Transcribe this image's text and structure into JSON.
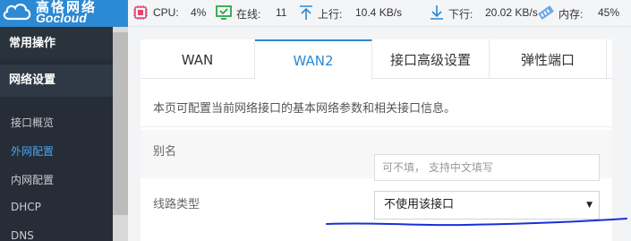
{
  "brand": {
    "name_cn": "高恪网络",
    "name_en": "Gocloud",
    "color": "#2c89d3"
  },
  "sidebar": {
    "groups": [
      {
        "label": "常用操作"
      },
      {
        "label": "网络设置"
      }
    ],
    "items": [
      {
        "label": "接口概览",
        "active": false
      },
      {
        "label": "外网配置",
        "active": true
      },
      {
        "label": "内网配置",
        "active": false
      },
      {
        "label": "DHCP",
        "active": false
      },
      {
        "label": "DNS",
        "active": false
      }
    ]
  },
  "status": {
    "cpu_label": "CPU:",
    "cpu_value": "4%",
    "online_label": "在线:",
    "online_value": "11",
    "upload_label": "上行:",
    "upload_value": "10.4 KB/s",
    "download_label": "下行:",
    "download_value": "20.02 KB/s",
    "memory_label": "内存:",
    "memory_value": "45%",
    "icons": [
      "cpu-icon",
      "monitor-icon",
      "upload-arrow-icon",
      "download-arrow-icon",
      "memory-icon"
    ]
  },
  "tabs": [
    {
      "label": "WAN",
      "active": false
    },
    {
      "label": "WAN2",
      "active": true
    },
    {
      "label": "接口高级设置",
      "active": false
    },
    {
      "label": "弹性端口",
      "active": false
    }
  ],
  "page": {
    "description": "本页可配置当前网络接口的基本网络参数和相关接口信息。"
  },
  "form": {
    "alias": {
      "label": "别名",
      "placeholder": "可不填， 支持中文填写",
      "value": ""
    },
    "line_type": {
      "label": "线路类型",
      "selected": "不使用该接口"
    }
  }
}
